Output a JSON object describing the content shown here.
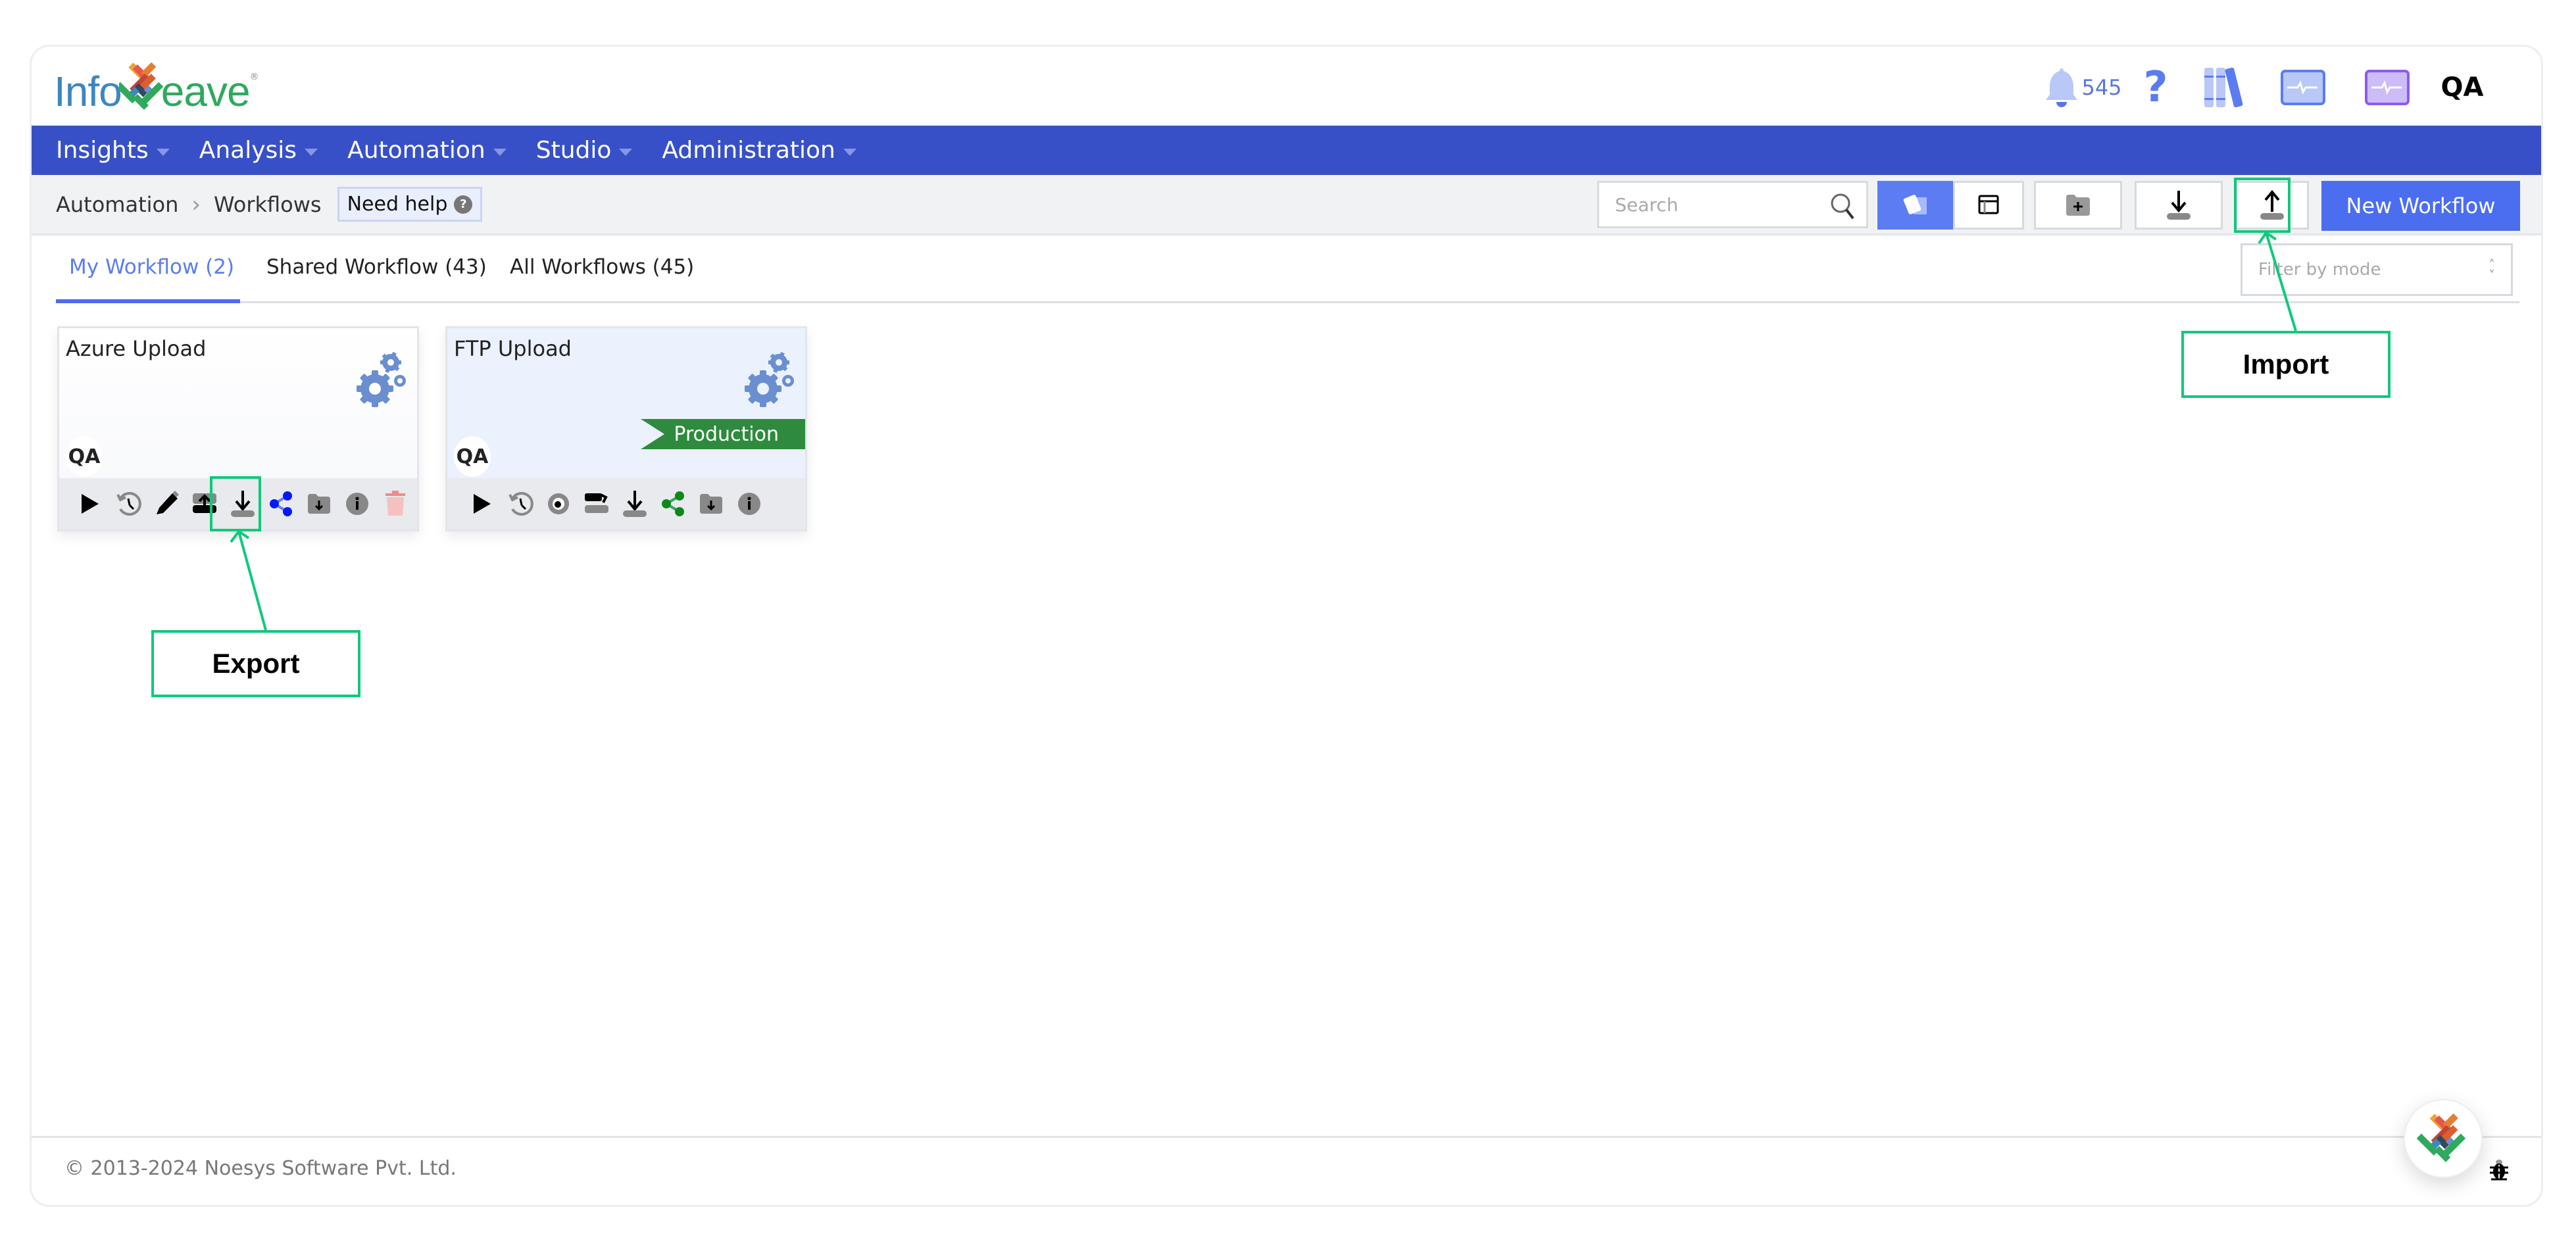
{
  "app": {
    "logo_text_left": "Info",
    "logo_text_right": "eave",
    "brand_color": "#3850c7"
  },
  "header": {
    "notification_count": "545",
    "help_glyph": "?",
    "user_badge": "QA",
    "icons": [
      "bell-icon",
      "help-icon",
      "library-icon",
      "monitor-icon",
      "monitor-purple-icon",
      "user-avatar"
    ]
  },
  "nav": {
    "items": [
      {
        "label": "Insights"
      },
      {
        "label": "Analysis"
      },
      {
        "label": "Automation"
      },
      {
        "label": "Studio"
      },
      {
        "label": "Administration"
      }
    ]
  },
  "breadcrumb": {
    "items": [
      "Automation",
      "Workflows"
    ],
    "separator": "›",
    "help_label": "Need help",
    "help_icon_glyph": "?"
  },
  "toolbar": {
    "search_placeholder": "Search",
    "view_card_label": "card-view",
    "view_table_label": "table-view",
    "new_folder_label": "new-folder",
    "download_label": "download",
    "import_label": "import",
    "new_workflow_label": "New Workflow"
  },
  "tabs": [
    {
      "label": "My Workflow (2)",
      "active": true
    },
    {
      "label": "Shared Workflow (43)",
      "active": false
    },
    {
      "label": "All Workflows (45)",
      "active": false
    }
  ],
  "filter": {
    "placeholder": "Filter by mode"
  },
  "workflows": [
    {
      "name": "Azure Upload",
      "owner": "QA",
      "badge": "",
      "actions": [
        "run",
        "history",
        "edit",
        "publish",
        "export",
        "share",
        "move-to-folder",
        "info",
        "delete"
      ]
    },
    {
      "name": "FTP Upload",
      "owner": "QA",
      "badge": "Production",
      "actions": [
        "run",
        "history",
        "view",
        "switch-mode",
        "export",
        "share",
        "move-to-folder",
        "info"
      ]
    }
  ],
  "footer": {
    "copyright": "© 2013-2024 Noesys Software Pvt. Ltd."
  },
  "annotations": {
    "export_label": "Export",
    "import_label": "Import",
    "color": "#10c97a"
  }
}
